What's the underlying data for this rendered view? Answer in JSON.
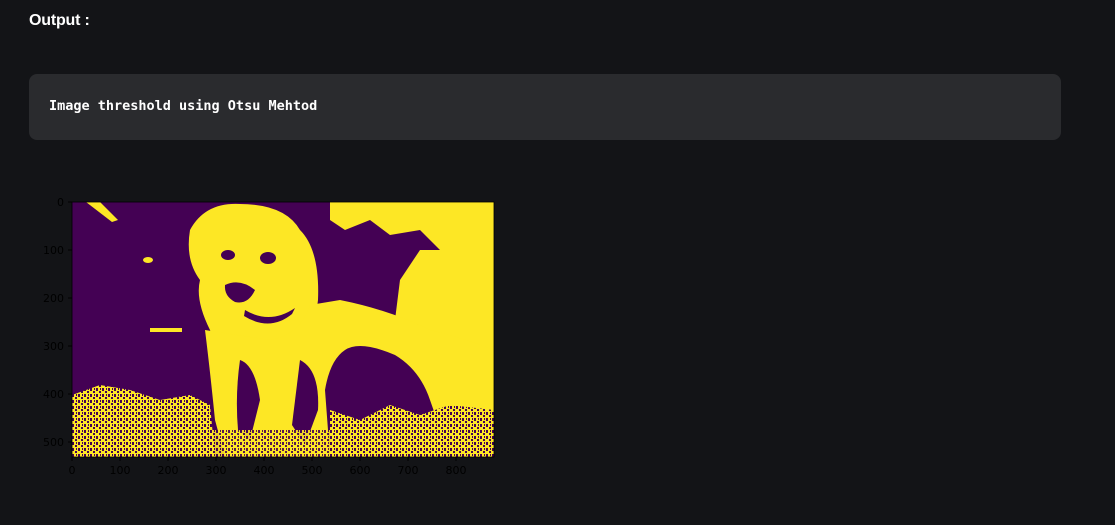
{
  "output": {
    "label": "Output :"
  },
  "code_block": {
    "text": "Image threshold using Otsu Mehtod"
  },
  "colors": {
    "background": "#131417",
    "code_block_bg": "#2a2b2e",
    "threshold_low": "#440154",
    "threshold_high": "#fde725"
  },
  "image_plot": {
    "description_icon": "image-icon",
    "x_ticks": [
      "0",
      "100",
      "200",
      "300",
      "400",
      "500",
      "600",
      "700",
      "800"
    ],
    "y_ticks": [
      "0",
      "100",
      "200",
      "300",
      "400",
      "500"
    ]
  }
}
